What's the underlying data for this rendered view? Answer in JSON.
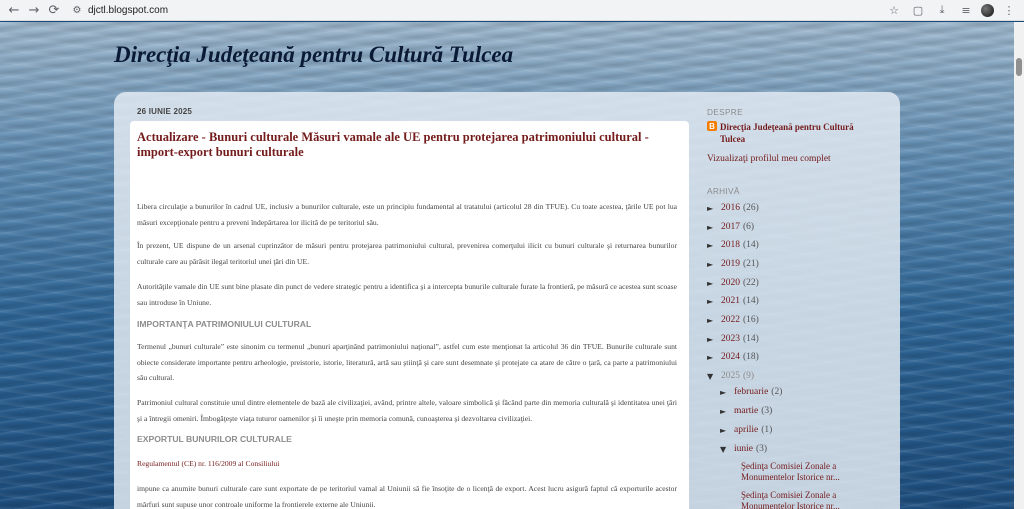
{
  "browser": {
    "url": "djctl.blogspot.com",
    "icons": {
      "back": "arrow-left-icon",
      "forward": "arrow-right-icon",
      "reload": "reload-icon",
      "site_info": "site-info-icon",
      "star": "star-icon",
      "extensions": "puzzle-icon",
      "download": "download-icon",
      "media": "media-control-icon",
      "menu": "menu-dots-icon"
    }
  },
  "blog": {
    "title": "Direcţia Judeţeană pentru Cultură Tulcea"
  },
  "post": {
    "date": "26 IUNIE 2025",
    "title": "Actualizare - Bunuri culturale Măsuri vamale ale UE pentru protejarea patrimoniului cultural - import-export bunuri culturale",
    "paragraphs": [
      "Libera circulaţie a bunurilor în cadrul UE, inclusiv a bunurilor culturale, este un principiu fundamental al tratatului (articolul 28 din TFUE). Cu toate acestea, ţările UE pot lua măsuri excepţionale pentru a preveni îndepărtarea lor ilicită de pe teritoriul său.",
      "În prezent, UE dispune de un arsenal cuprinzător de măsuri pentru protejarea patrimoniului cultural, prevenirea comerţului ilicit cu bunuri culturale şi returnarea bunurilor culturale care au părăsit ilegal teritoriul unei ţări din UE.",
      "Autorităţile vamale din UE sunt bine plasate din punct de vedere strategic pentru a identifica şi a intercepta bunurile culturale furate la frontieră, pe măsură ce acestea sunt scoase sau introduse în Uniune.",
      "Termenul „bunuri culturale” este sinonim cu termenul „bunuri aparţinând patrimoniului naţional”, astfel cum este menţionat la articolul 36 din TFUE. Bunurile culturale sunt obiecte considerate importante pentru arheologie, preistorie, istorie, literatură, artă sau ştiinţă şi care sunt desemnate şi protejate ca atare de către o ţară, ca parte a patrimoniului său cultural.",
      "Patrimoniul cultural constituie unul dintre elementele de bază ale civilizaţiei, având, printre altele, valoare simbolică şi făcând parte din memoria culturală şi identitatea unei ţări şi a întregii omeniri. Îmbogăţeşte viaţa tuturor oamenilor şi îi uneşte prin memoria comună, cunoaşterea şi dezvoltarea civilizaţiei.",
      "impune ca anumite bunuri culturale care sunt exportate de pe teritoriul vamal al Uniunii să fie însoţite de o licenţă de export. Acest lucru asigură faptul că exporturile acestor mărfuri sunt supuse unor controale uniforme la frontierele externe ale Uniunii."
    ],
    "subheadings": [
      "IMPORTANŢA PATRIMONIULUI CULTURAL",
      "EXPORTUL BUNURILOR CULTURALE"
    ],
    "regulation_link": "Regulamentul (CE) nr. 116/2009 al Consiliului"
  },
  "sidebar": {
    "about_heading": "DESPRE",
    "profile_name": "Direcţia Judeţeană pentru Cultură Tulcea",
    "profile_link": "Vizualizaţi profilul meu complet",
    "archive_heading": "ARHIVĂ",
    "archive": [
      {
        "toggle": "►",
        "year": "2016",
        "count": "(26)"
      },
      {
        "toggle": "►",
        "year": "2017",
        "count": "(6)"
      },
      {
        "toggle": "►",
        "year": "2018",
        "count": "(14)"
      },
      {
        "toggle": "►",
        "year": "2019",
        "count": "(21)"
      },
      {
        "toggle": "►",
        "year": "2020",
        "count": "(22)"
      },
      {
        "toggle": "►",
        "year": "2021",
        "count": "(14)"
      },
      {
        "toggle": "►",
        "year": "2022",
        "count": "(16)"
      },
      {
        "toggle": "►",
        "year": "2023",
        "count": "(14)"
      },
      {
        "toggle": "►",
        "year": "2024",
        "count": "(18)"
      },
      {
        "toggle": "▼",
        "year": "2025",
        "count": "(9)"
      }
    ],
    "months": [
      {
        "toggle": "►",
        "name": "februarie",
        "count": "(2)"
      },
      {
        "toggle": "►",
        "name": "martie",
        "count": "(3)"
      },
      {
        "toggle": "►",
        "name": "aprilie",
        "count": "(1)"
      },
      {
        "toggle": "▼",
        "name": "iunie",
        "count": "(3)"
      }
    ],
    "posts": [
      "Şedinţa Comisiei Zonale a Monumentelor Istorice nr...",
      "Şedinţa Comisiei Zonale a Monumentelor Istorice nr..."
    ]
  }
}
